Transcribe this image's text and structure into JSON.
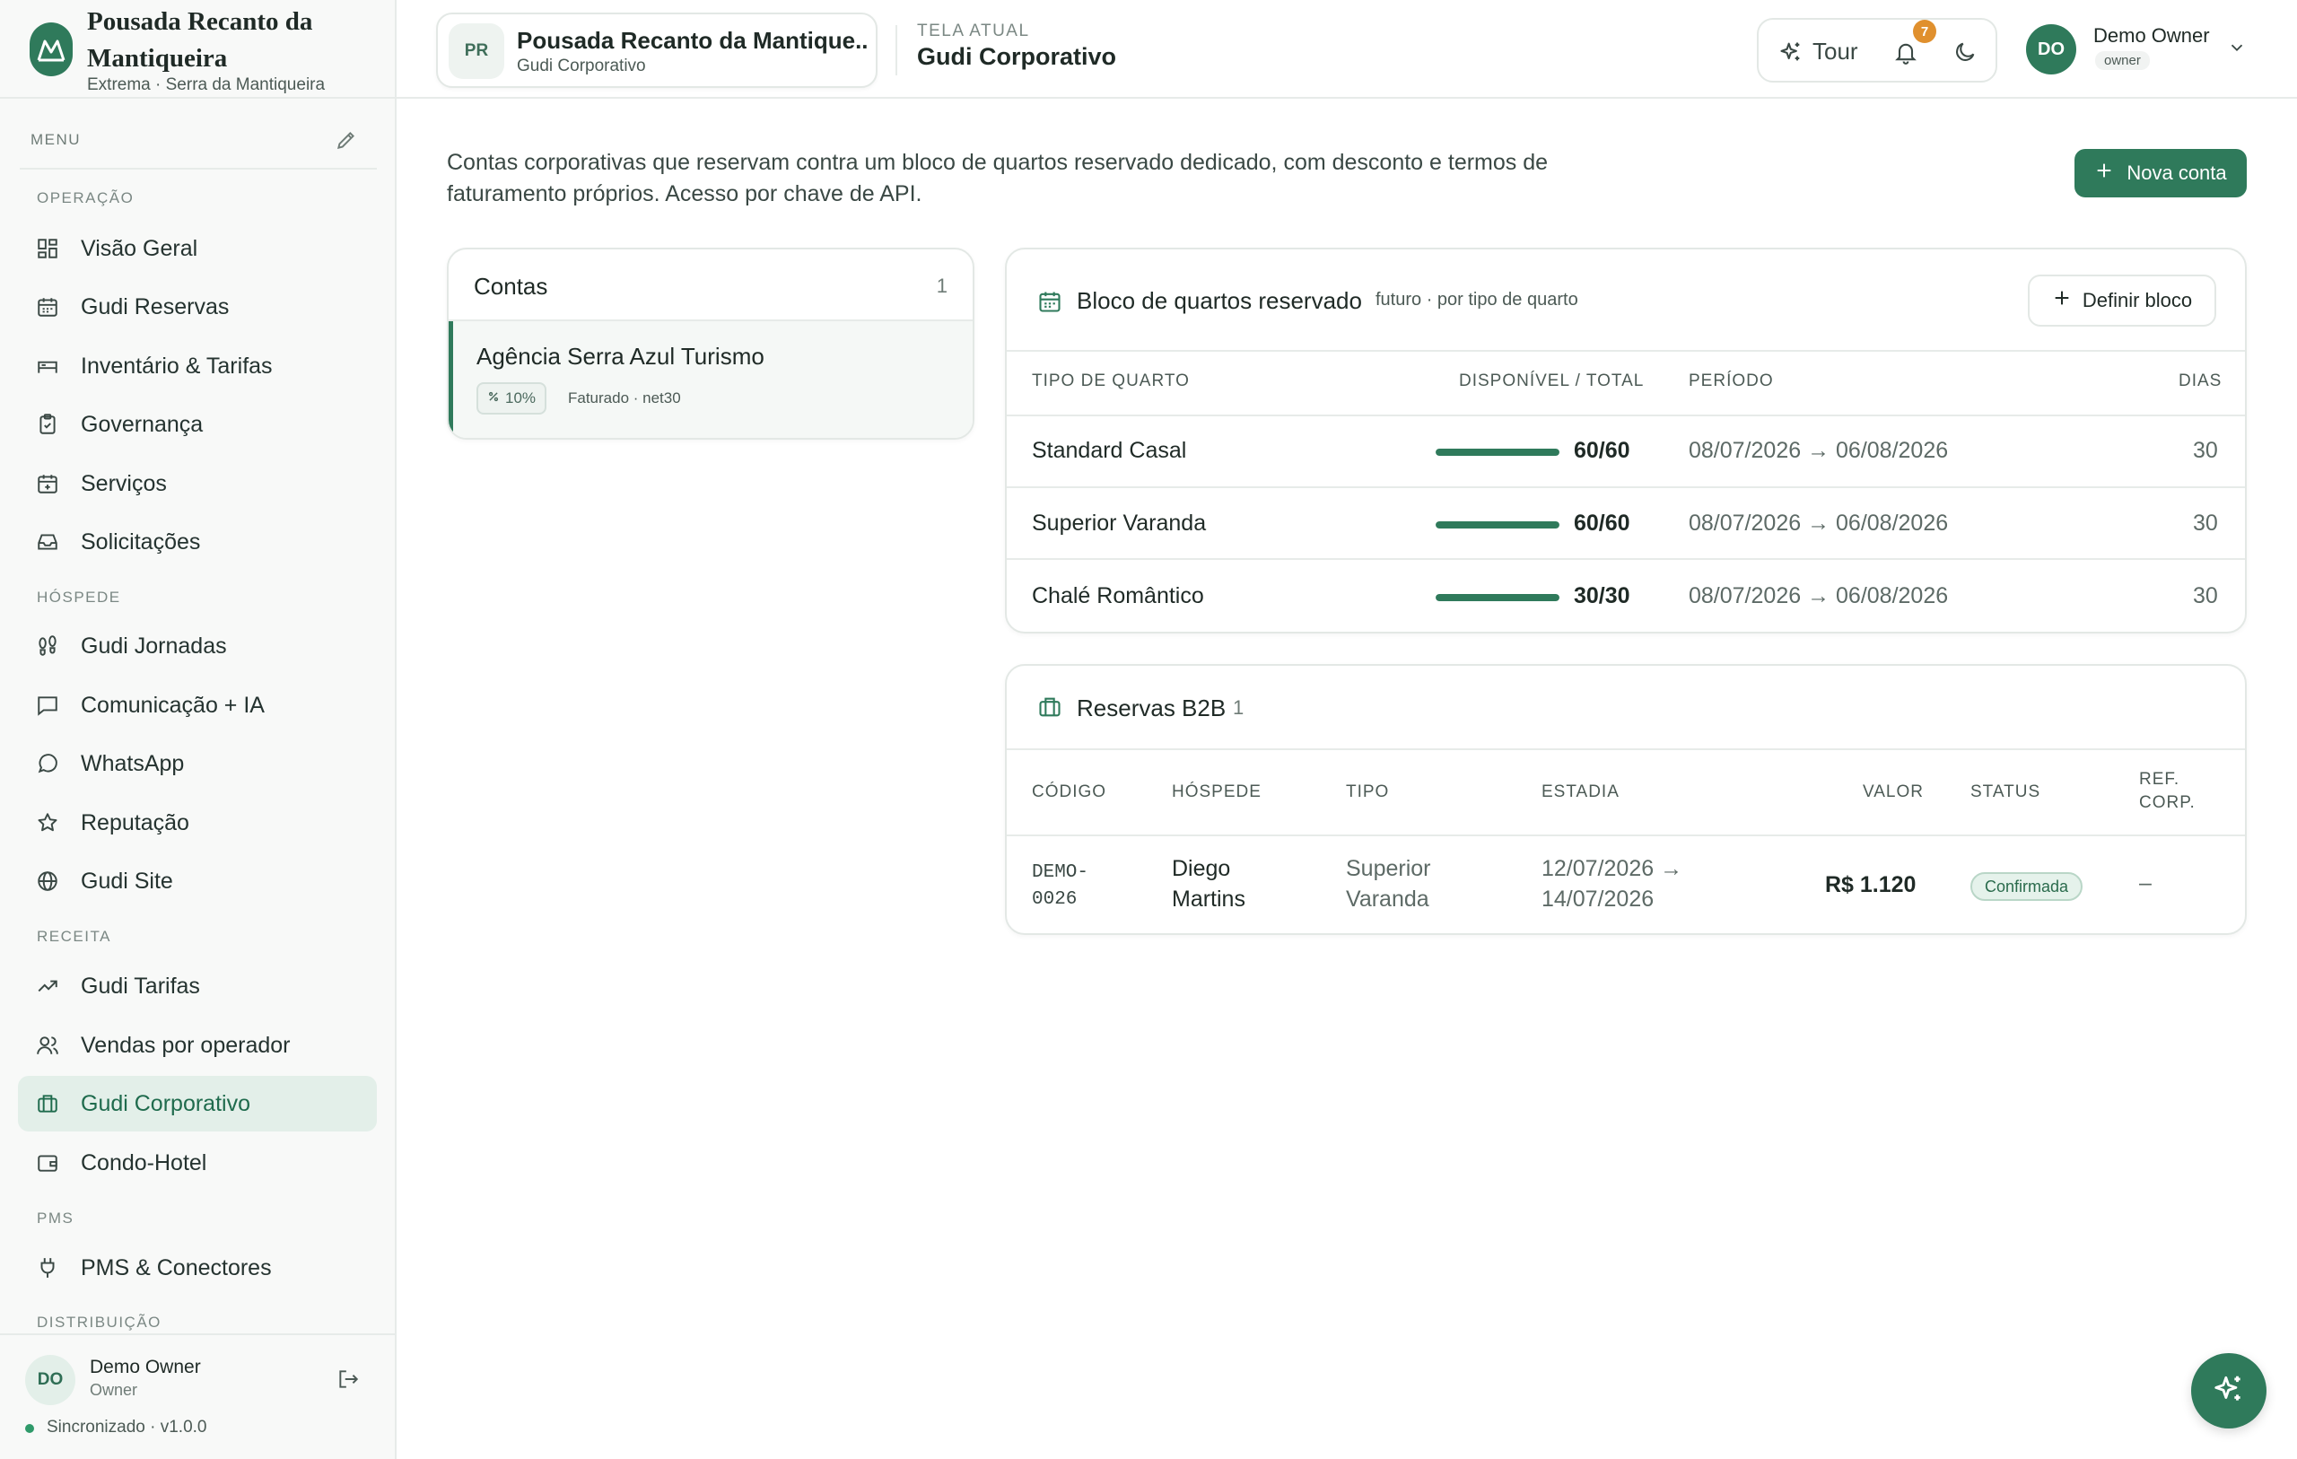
{
  "brand": {
    "name": "Pousada Recanto da Mantiqueira",
    "subtitle": "Extrema · Serra da Mantiqueira"
  },
  "sidebar": {
    "menu_label": "MENU",
    "sections": {
      "operacao": "OPERAÇÃO",
      "hospede": "HÓSPEDE",
      "receita": "RECEITA",
      "pms": "PMS",
      "distribuicao": "DISTRIBUIÇÃO"
    },
    "items": [
      {
        "label": "Visão Geral",
        "icon": "dashboard-icon"
      },
      {
        "label": "Gudi Reservas",
        "icon": "calendar-icon"
      },
      {
        "label": "Inventário & Tarifas",
        "icon": "bed-icon"
      },
      {
        "label": "Governança",
        "icon": "clipboard-icon"
      },
      {
        "label": "Serviços",
        "icon": "calendar-plus-icon"
      },
      {
        "label": "Solicitações",
        "icon": "inbox-icon"
      },
      {
        "label": "Gudi Jornadas",
        "icon": "footprints-icon"
      },
      {
        "label": "Comunicação + IA",
        "icon": "message-square-icon"
      },
      {
        "label": "WhatsApp",
        "icon": "chat-bubble-icon"
      },
      {
        "label": "Reputação",
        "icon": "star-icon"
      },
      {
        "label": "Gudi Site",
        "icon": "globe-icon"
      },
      {
        "label": "Gudi Tarifas",
        "icon": "trending-up-icon"
      },
      {
        "label": "Vendas por operador",
        "icon": "users-icon"
      },
      {
        "label": "Gudi Corporativo",
        "icon": "briefcase-icon",
        "active": true
      },
      {
        "label": "Condo-Hotel",
        "icon": "wallet-icon"
      },
      {
        "label": "PMS & Conectores",
        "icon": "plug-icon"
      }
    ],
    "footer": {
      "initials": "DO",
      "name": "Demo Owner",
      "role": "Owner",
      "sync": "Sincronizado · v1.0.0"
    }
  },
  "topbar": {
    "property": {
      "initials": "PR",
      "name": "Pousada Recanto da Mantiqueira",
      "name_display": "Pousada Recanto da Mantique...",
      "sub": "Gudi Corporativo"
    },
    "screen_caption": "TELA ATUAL",
    "screen_value": "Gudi Corporativo",
    "tour_label": "Tour",
    "notifications_count": "7",
    "user": {
      "initials": "DO",
      "name": "Demo Owner",
      "role": "owner"
    }
  },
  "main": {
    "intro": "Contas corporativas que reservam contra um bloco de quartos reservado dedicado, com desconto e termos de faturamento próprios. Acesso por chave de API.",
    "new_account_label": "Nova conta",
    "contas": {
      "title": "Contas",
      "count": "1",
      "items": [
        {
          "name": "Agência Serra Azul Turismo",
          "discount": "10%",
          "billing": "Faturado · net30"
        }
      ]
    },
    "bloco": {
      "title": "Bloco de quartos reservado",
      "subtitle": "futuro · por tipo de quarto",
      "define_label": "Definir bloco",
      "headers": {
        "tipo": "TIPO DE QUARTO",
        "disp": "DISPONÍVEL / TOTAL",
        "periodo": "PERÍODO",
        "dias": "DIAS"
      },
      "rows": [
        {
          "tipo": "Standard Casal",
          "available": "60/60",
          "fill": 1.0,
          "periodo": "08/07/2026 → 06/08/2026",
          "dias": "30"
        },
        {
          "tipo": "Superior Varanda",
          "available": "60/60",
          "fill": 1.0,
          "periodo": "08/07/2026 → 06/08/2026",
          "dias": "30"
        },
        {
          "tipo": "Chalé Romântico",
          "available": "30/30",
          "fill": 1.0,
          "periodo": "08/07/2026 → 06/08/2026",
          "dias": "30"
        }
      ]
    },
    "b2b": {
      "title": "Reservas B2B",
      "count": "1",
      "headers": {
        "codigo": "CÓDIGO",
        "hospede": "HÓSPEDE",
        "tipo": "TIPO",
        "estadia": "ESTADIA",
        "valor": "VALOR",
        "status": "STATUS",
        "ref1": "REF.",
        "ref2": "CORP."
      },
      "rows": [
        {
          "codigo1": "DEMO-",
          "codigo2": "0026",
          "hospede1": "Diego",
          "hospede2": "Martins",
          "tipo1": "Superior",
          "tipo2": "Varanda",
          "estadia1": "12/07/2026 →",
          "estadia2": "14/07/2026",
          "valor": "R$ 1.120",
          "status": "Confirmada",
          "ref": "–"
        }
      ]
    }
  },
  "colors": {
    "accent": "#2f7a5b",
    "accent_soft": "#e3efe9",
    "badge": "#e0902e"
  }
}
